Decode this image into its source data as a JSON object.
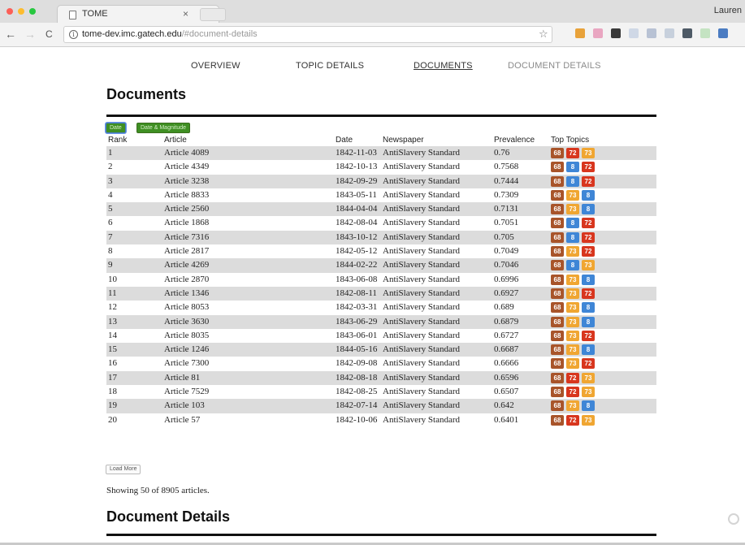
{
  "browser": {
    "tab_title": "TOME",
    "tab_close": "×",
    "profile_name": "Lauren",
    "url_host": "tome-dev.imc.gatech.edu",
    "url_path": "/#document-details",
    "back_glyph": "←",
    "forward_glyph": "→",
    "reload_glyph": "C",
    "star_glyph": "☆"
  },
  "nav": {
    "items": [
      "OVERVIEW",
      "TOPIC DETAILS",
      "DOCUMENTS",
      "DOCUMENT DETAILS"
    ],
    "active": "DOCUMENTS"
  },
  "documents": {
    "heading": "Documents",
    "sort_buttons": [
      "Date",
      "Date & Magnitude"
    ],
    "columns": [
      "Rank",
      "Article",
      "Date",
      "Newspaper",
      "Prevalence",
      "Top Topics"
    ],
    "rows": [
      {
        "rank": "1",
        "article": "Article 4089",
        "date": "1842-11-03",
        "newspaper": "AntiSlavery Standard",
        "prevalence": "0.76",
        "topics": [
          "68",
          "72",
          "73"
        ]
      },
      {
        "rank": "2",
        "article": "Article 4349",
        "date": "1842-10-13",
        "newspaper": "AntiSlavery Standard",
        "prevalence": "0.7568",
        "topics": [
          "68",
          "8",
          "72"
        ]
      },
      {
        "rank": "3",
        "article": "Article 3238",
        "date": "1842-09-29",
        "newspaper": "AntiSlavery Standard",
        "prevalence": "0.7444",
        "topics": [
          "68",
          "8",
          "72"
        ]
      },
      {
        "rank": "4",
        "article": "Article 8833",
        "date": "1843-05-11",
        "newspaper": "AntiSlavery Standard",
        "prevalence": "0.7309",
        "topics": [
          "68",
          "73",
          "8"
        ]
      },
      {
        "rank": "5",
        "article": "Article 2560",
        "date": "1844-04-04",
        "newspaper": "AntiSlavery Standard",
        "prevalence": "0.7131",
        "topics": [
          "68",
          "73",
          "8"
        ]
      },
      {
        "rank": "6",
        "article": "Article 1868",
        "date": "1842-08-04",
        "newspaper": "AntiSlavery Standard",
        "prevalence": "0.7051",
        "topics": [
          "68",
          "8",
          "72"
        ]
      },
      {
        "rank": "7",
        "article": "Article 7316",
        "date": "1843-10-12",
        "newspaper": "AntiSlavery Standard",
        "prevalence": "0.705",
        "topics": [
          "68",
          "8",
          "72"
        ]
      },
      {
        "rank": "8",
        "article": "Article 2817",
        "date": "1842-05-12",
        "newspaper": "AntiSlavery Standard",
        "prevalence": "0.7049",
        "topics": [
          "68",
          "73",
          "72"
        ]
      },
      {
        "rank": "9",
        "article": "Article 4269",
        "date": "1844-02-22",
        "newspaper": "AntiSlavery Standard",
        "prevalence": "0.7046",
        "topics": [
          "68",
          "8",
          "73"
        ]
      },
      {
        "rank": "10",
        "article": "Article 2870",
        "date": "1843-06-08",
        "newspaper": "AntiSlavery Standard",
        "prevalence": "0.6996",
        "topics": [
          "68",
          "73",
          "8"
        ]
      },
      {
        "rank": "11",
        "article": "Article 1346",
        "date": "1842-08-11",
        "newspaper": "AntiSlavery Standard",
        "prevalence": "0.6927",
        "topics": [
          "68",
          "73",
          "72"
        ]
      },
      {
        "rank": "12",
        "article": "Article 8053",
        "date": "1842-03-31",
        "newspaper": "AntiSlavery Standard",
        "prevalence": "0.689",
        "topics": [
          "68",
          "73",
          "8"
        ]
      },
      {
        "rank": "13",
        "article": "Article 3630",
        "date": "1843-06-29",
        "newspaper": "AntiSlavery Standard",
        "prevalence": "0.6879",
        "topics": [
          "68",
          "73",
          "8"
        ]
      },
      {
        "rank": "14",
        "article": "Article 8035",
        "date": "1843-06-01",
        "newspaper": "AntiSlavery Standard",
        "prevalence": "0.6727",
        "topics": [
          "68",
          "73",
          "72"
        ]
      },
      {
        "rank": "15",
        "article": "Article 1246",
        "date": "1844-05-16",
        "newspaper": "AntiSlavery Standard",
        "prevalence": "0.6687",
        "topics": [
          "68",
          "73",
          "8"
        ]
      },
      {
        "rank": "16",
        "article": "Article 7300",
        "date": "1842-09-08",
        "newspaper": "AntiSlavery Standard",
        "prevalence": "0.6666",
        "topics": [
          "68",
          "73",
          "72"
        ]
      },
      {
        "rank": "17",
        "article": "Article 81",
        "date": "1842-08-18",
        "newspaper": "AntiSlavery Standard",
        "prevalence": "0.6596",
        "topics": [
          "68",
          "72",
          "73"
        ]
      },
      {
        "rank": "18",
        "article": "Article 7529",
        "date": "1842-08-25",
        "newspaper": "AntiSlavery Standard",
        "prevalence": "0.6507",
        "topics": [
          "68",
          "72",
          "73"
        ]
      },
      {
        "rank": "19",
        "article": "Article 103",
        "date": "1842-07-14",
        "newspaper": "AntiSlavery Standard",
        "prevalence": "0.642",
        "topics": [
          "68",
          "73",
          "8"
        ]
      },
      {
        "rank": "20",
        "article": "Article 57",
        "date": "1842-10-06",
        "newspaper": "AntiSlavery Standard",
        "prevalence": "0.6401",
        "topics": [
          "68",
          "72",
          "73"
        ]
      }
    ],
    "load_more": "Load More",
    "showing": "Showing 50 of 8905 articles."
  },
  "document_details": {
    "heading": "Document Details"
  },
  "topic_colors": {
    "68": "#a8542a",
    "72": "#d8361e",
    "73": "#f0a632",
    "8": "#3f86d6"
  },
  "extension_colors": [
    "#e8a23a",
    "#e9a6c1",
    "#3a3a3a",
    "#cfd8e6",
    "#b8c2d4",
    "#c7d0dc",
    "#4e5a66",
    "#c4e3c2",
    "#4b7cc2"
  ]
}
